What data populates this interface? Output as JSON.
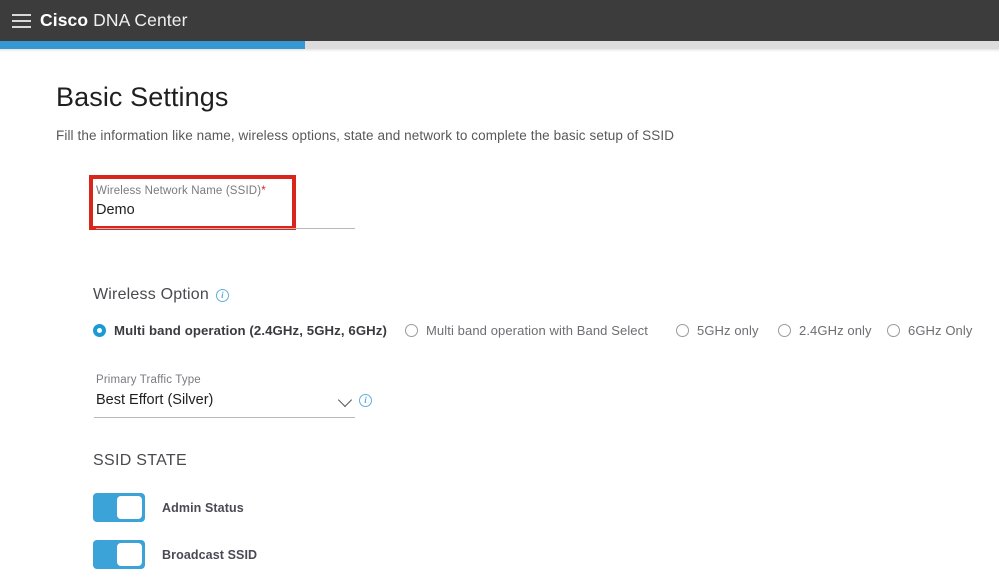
{
  "header": {
    "menu_icon": "hamburger-icon",
    "brand_bold": "Cisco",
    "brand_light": "DNA Center"
  },
  "progress": {
    "percent": 30.5,
    "fill_color": "#3598d3",
    "track_color": "#dcdcdc"
  },
  "page": {
    "title": "Basic Settings",
    "subtitle": "Fill the information like name, wireless options, state and network to complete the basic setup of SSID"
  },
  "ssid_field": {
    "label": "Wireless Network Name (SSID)",
    "required_marker": "*",
    "value": "Demo",
    "placeholder": "Wireless Network Name (SSID)",
    "highlight_color": "#d9261c",
    "highlighted": true
  },
  "wireless_option": {
    "heading": "Wireless Option",
    "info_icon": "info-circle-icon",
    "options": [
      {
        "label": "Multi band operation (2.4GHz, 5GHz, 6GHz)",
        "selected": true
      },
      {
        "label": "Multi band operation with Band Select",
        "selected": false
      },
      {
        "label": "5GHz only",
        "selected": false
      },
      {
        "label": "2.4GHz only",
        "selected": false
      },
      {
        "label": "6GHz Only",
        "selected": false
      }
    ],
    "selected_color": "#1c9ad6"
  },
  "primary_traffic_type": {
    "label": "Primary Traffic Type",
    "value": "Best Effort (Silver)",
    "chevron_icon": "chevron-down-icon",
    "info_icon": "info-circle-icon"
  },
  "ssid_state": {
    "heading": "SSID STATE",
    "toggles": [
      {
        "label": "Admin Status",
        "on": true
      },
      {
        "label": "Broadcast SSID",
        "on": true
      }
    ],
    "on_color": "#3ba3d8"
  }
}
